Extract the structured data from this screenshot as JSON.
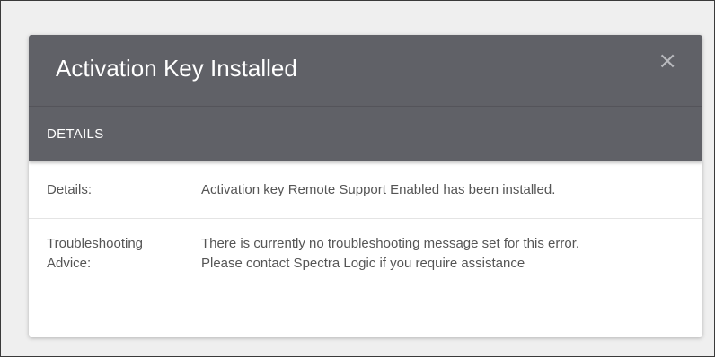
{
  "dialog": {
    "title": "Activation Key Installed",
    "close_glyph": "×",
    "section_label": "DETAILS",
    "rows": [
      {
        "label": "Details:",
        "value": "Activation key Remote Support Enabled has been installed."
      },
      {
        "label_line1": "Troubleshooting",
        "label_line2": "Advice:",
        "value_line1": "There is currently no troubleshooting message set for this error.",
        "value_line2": "Please contact Spectra Logic if you require assistance"
      }
    ]
  },
  "icons": {
    "close": "close-icon"
  },
  "colors": {
    "header_bg": "#606167",
    "backdrop": "#efefef",
    "text_muted": "#555555"
  }
}
